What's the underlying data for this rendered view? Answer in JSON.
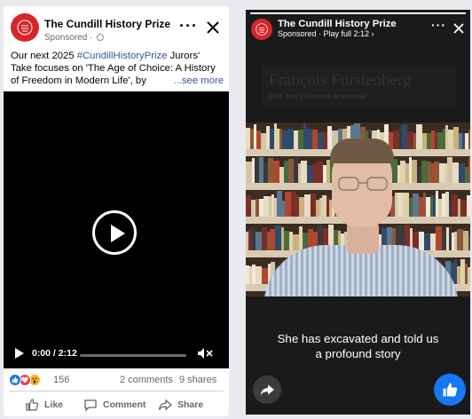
{
  "feed_post": {
    "page_name": "The Cundill History Prize",
    "sponsored_label": "Sponsored",
    "globe_separator": "·",
    "more_icon": "···",
    "text_line1": "Our next 2025 ",
    "hashtag": "#CundillHistoryPrize",
    "text_line1_end": " Jurors'",
    "text_line2": "Take focuses on 'The Age of Choice: A History",
    "text_line3": "of Freedom in Modern Life', by",
    "see_more": "...see more",
    "video": {
      "time": "0:00 / 2:12",
      "progress": 0.0
    },
    "reaction_count": "156",
    "comments": "2 comments",
    "shares": "9 shares",
    "actions": {
      "like": "Like",
      "comment": "Comment",
      "share": "Share"
    },
    "icons": [
      "like-reaction-icon",
      "love-reaction-icon",
      "wow-reaction-icon",
      "play-icon",
      "mute-icon",
      "close-icon"
    ]
  },
  "story": {
    "page_name": "The Cundill History Prize",
    "subtitle": "Sponsored · Play full 2:12 ›",
    "more_icon": "···",
    "lower_third_name": "François Furstenberg",
    "lower_third_role": "2025 Juror | Université de Montréal",
    "caption_line1": "She has excavated and told us",
    "caption_line2": "a profound story",
    "progress": 1.0,
    "colors": {
      "accent": "#1877f2",
      "brand": "#d7262b"
    }
  }
}
